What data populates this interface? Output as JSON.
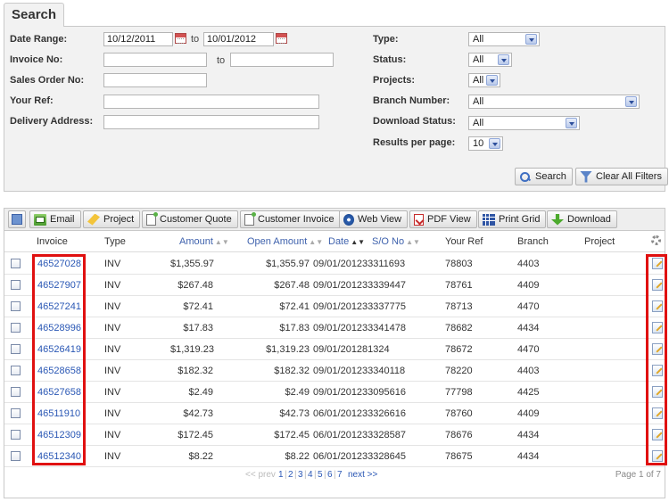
{
  "search": {
    "title": "Search",
    "labels": {
      "date_range": "Date Range:",
      "invoice_no": "Invoice No:",
      "sales_order_no": "Sales Order No:",
      "your_ref": "Your Ref:",
      "delivery_address": "Delivery Address:",
      "type": "Type:",
      "status": "Status:",
      "projects": "Projects:",
      "branch_number": "Branch Number:",
      "download_status": "Download Status:",
      "results_per_page": "Results per page:"
    },
    "date_from": "10/12/2011",
    "date_to": "10/01/2012",
    "to_text": "to",
    "type_value": "All",
    "status_value": "All",
    "projects_value": "All",
    "branch_value": "All",
    "download_status_value": "All",
    "results_value": "10",
    "search_button": "Search",
    "clear_button": "Clear All Filters"
  },
  "toolbar": {
    "email": "Email",
    "project": "Project",
    "customer_quote": "Customer Quote",
    "customer_invoice": "Customer Invoice",
    "web_view": "Web View",
    "pdf_view": "PDF View",
    "print_grid": "Print Grid",
    "download": "Download"
  },
  "table": {
    "headers": {
      "invoice": "Invoice",
      "type": "Type",
      "amount": "Amount",
      "open_amount": "Open Amount",
      "date": "Date",
      "so_no": "S/O No",
      "your_ref": "Your Ref",
      "branch": "Branch",
      "project": "Project"
    },
    "rows": [
      {
        "invoice": "46527028",
        "type": "INV",
        "amount": "$1,355.97",
        "open_amount": "$1,355.97",
        "date": "09/01/2012",
        "so_no": "33311693",
        "your_ref": "78803",
        "branch": "4403",
        "project": ""
      },
      {
        "invoice": "46527907",
        "type": "INV",
        "amount": "$267.48",
        "open_amount": "$267.48",
        "date": "09/01/2012",
        "so_no": "33339447",
        "your_ref": "78761",
        "branch": "4409",
        "project": ""
      },
      {
        "invoice": "46527241",
        "type": "INV",
        "amount": "$72.41",
        "open_amount": "$72.41",
        "date": "09/01/2012",
        "so_no": "33337775",
        "your_ref": "78713",
        "branch": "4470",
        "project": ""
      },
      {
        "invoice": "46528996",
        "type": "INV",
        "amount": "$17.83",
        "open_amount": "$17.83",
        "date": "09/01/2012",
        "so_no": "33341478",
        "your_ref": "78682",
        "branch": "4434",
        "project": ""
      },
      {
        "invoice": "46526419",
        "type": "INV",
        "amount": "$1,319.23",
        "open_amount": "$1,319.23",
        "date": "09/01/2012",
        "so_no": "81324",
        "your_ref": "78672",
        "branch": "4470",
        "project": ""
      },
      {
        "invoice": "46528658",
        "type": "INV",
        "amount": "$182.32",
        "open_amount": "$182.32",
        "date": "09/01/2012",
        "so_no": "33340118",
        "your_ref": "78220",
        "branch": "4403",
        "project": ""
      },
      {
        "invoice": "46527658",
        "type": "INV",
        "amount": "$2.49",
        "open_amount": "$2.49",
        "date": "09/01/2012",
        "so_no": "33095616",
        "your_ref": "77798",
        "branch": "4425",
        "project": ""
      },
      {
        "invoice": "46511910",
        "type": "INV",
        "amount": "$42.73",
        "open_amount": "$42.73",
        "date": "06/01/2012",
        "so_no": "33326616",
        "your_ref": "78760",
        "branch": "4409",
        "project": ""
      },
      {
        "invoice": "46512309",
        "type": "INV",
        "amount": "$172.45",
        "open_amount": "$172.45",
        "date": "06/01/2012",
        "so_no": "33328587",
        "your_ref": "78676",
        "branch": "4434",
        "project": ""
      },
      {
        "invoice": "46512340",
        "type": "INV",
        "amount": "$8.22",
        "open_amount": "$8.22",
        "date": "06/01/2012",
        "so_no": "33328645",
        "your_ref": "78675",
        "branch": "4434",
        "project": ""
      }
    ]
  },
  "pager": {
    "prev": "<< prev",
    "pages": [
      "1",
      "2",
      "3",
      "4",
      "5",
      "6",
      "7"
    ],
    "next": "next >>",
    "page_count": "Page 1 of 7"
  },
  "colors": {
    "highlight": "#e01010",
    "link": "#2b58b5"
  }
}
